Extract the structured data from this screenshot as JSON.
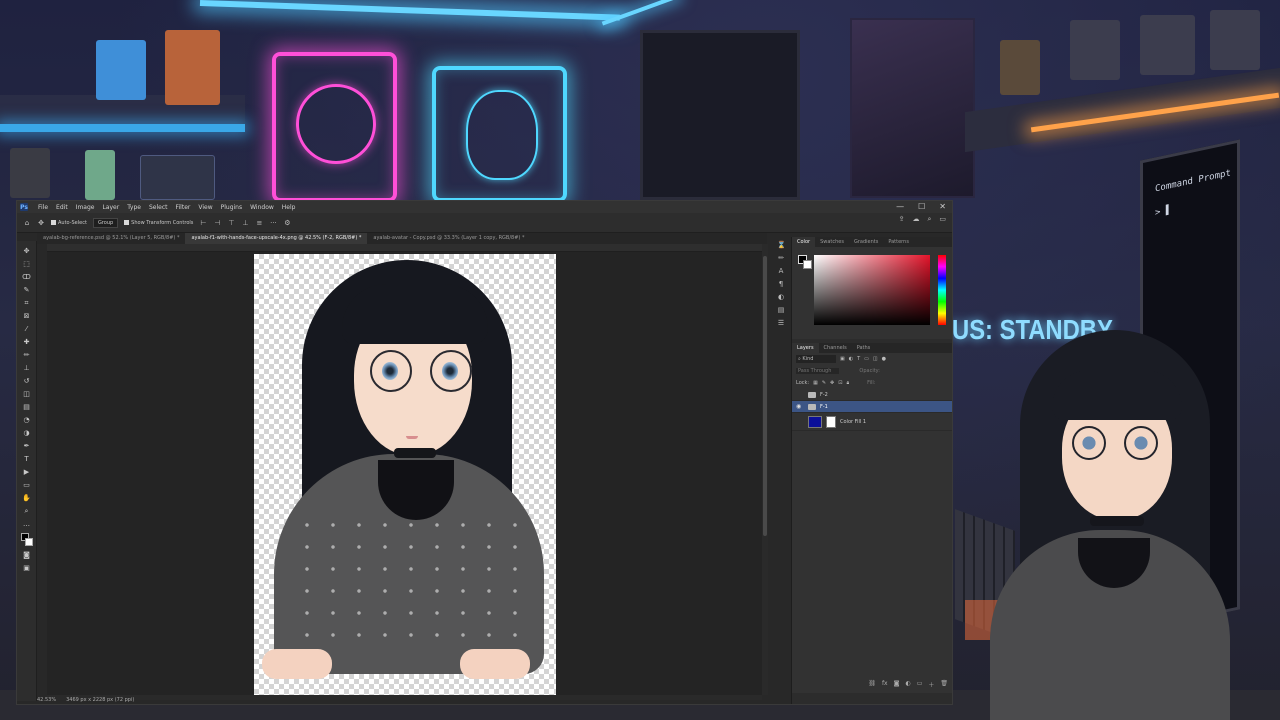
{
  "background": {
    "status_text": "US: STANDBY",
    "terminal_title": "Command Prompt",
    "terminal_prompt": "> ▌"
  },
  "app": {
    "logo": "Ps",
    "menu": [
      "File",
      "Edit",
      "Image",
      "Layer",
      "Type",
      "Select",
      "Filter",
      "View",
      "Plugins",
      "Window",
      "Help"
    ],
    "window_controls": [
      "—",
      "☐",
      "✕"
    ],
    "options": {
      "auto_select_label": "Auto-Select",
      "group_value": "Group",
      "show_transform_label": "Show Transform Controls",
      "more_icon": "···"
    },
    "tabs": [
      {
        "label": "ayalab-bg-reference.psd @ 52.1% (Layer 5, RGB/8#) *",
        "active": false
      },
      {
        "label": "ayalab-f1-with-hands-face-upscale-4x.png @ 42.5% (F-2, RGB/8#) *",
        "active": true
      },
      {
        "label": "ayalab-avatar - Copy.psd @ 33.3% (Layer 1 copy, RGB/8#) *",
        "active": false
      }
    ],
    "status": {
      "zoom": "42.53%",
      "doc_info": "3469 px x 2228 px (72 ppi)"
    },
    "panels": {
      "color_tabs": [
        "Color",
        "Swatches",
        "Gradients",
        "Patterns"
      ],
      "layers_tabs": [
        "Layers",
        "Channels",
        "Paths"
      ],
      "kind_label": "Kind",
      "blend_mode": "Pass Through",
      "opacity_label": "Opacity:",
      "lock_label": "Lock:",
      "fill_label": "Fill:",
      "layers": [
        {
          "name": "F-2",
          "type": "group",
          "selected": false,
          "visible": false
        },
        {
          "name": "F-1",
          "type": "group",
          "selected": true,
          "visible": true
        },
        {
          "name": "Color Fill 1",
          "type": "fill",
          "selected": false,
          "visible": false
        }
      ]
    },
    "colors": {
      "foreground": "#000000",
      "background": "#ffffff",
      "fill_layer": "#0b0f9a",
      "selection": "#3c5585"
    }
  }
}
